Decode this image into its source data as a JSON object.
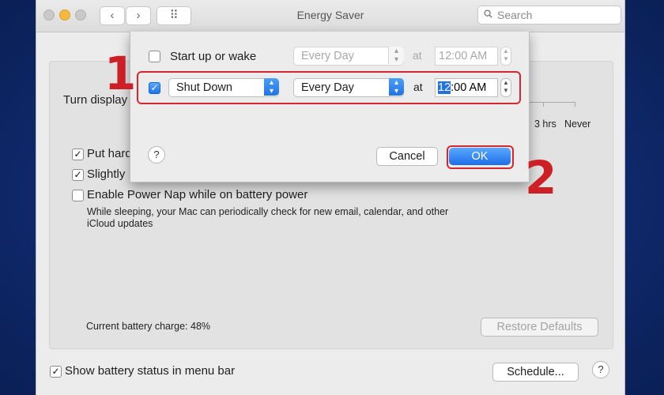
{
  "window": {
    "title": "Energy Saver",
    "back_icon": "‹",
    "forward_icon": "›",
    "grid_icon": "⠿",
    "search_placeholder": "Search"
  },
  "panel": {
    "turn_display_label": "Turn display",
    "slider_labels": [
      "3 hrs",
      "Never"
    ],
    "options": [
      {
        "label": "Put hard",
        "checked": true
      },
      {
        "label": "Slightly",
        "checked": true
      },
      {
        "label": "Enable Power Nap while on battery power",
        "checked": false
      }
    ],
    "power_nap_desc_1": "While sleeping, your Mac can periodically check for new email, calendar, and other",
    "power_nap_desc_2": "iCloud updates",
    "battery_charge": "Current battery charge: 48%",
    "restore_defaults": "Restore Defaults",
    "show_battery_status": "Show battery status in menu bar",
    "show_battery_checked": true,
    "schedule_button": "Schedule...",
    "help": "?"
  },
  "sheet": {
    "row1": {
      "checked": false,
      "label": "Start up or wake",
      "frequency": "Every Day",
      "at": "at",
      "time": "12:00 AM"
    },
    "row2": {
      "checked": true,
      "action": "Shut Down",
      "frequency": "Every Day",
      "at": "at",
      "time_selected": "12",
      "time_rest": ":00 AM"
    },
    "help": "?",
    "cancel": "Cancel",
    "ok": "OK"
  },
  "annotations": {
    "step1": "1",
    "step2": "2",
    "color": "#cc1f26"
  },
  "colors": {
    "accent": "#1f73e5",
    "highlight_box": "#d6272e"
  }
}
